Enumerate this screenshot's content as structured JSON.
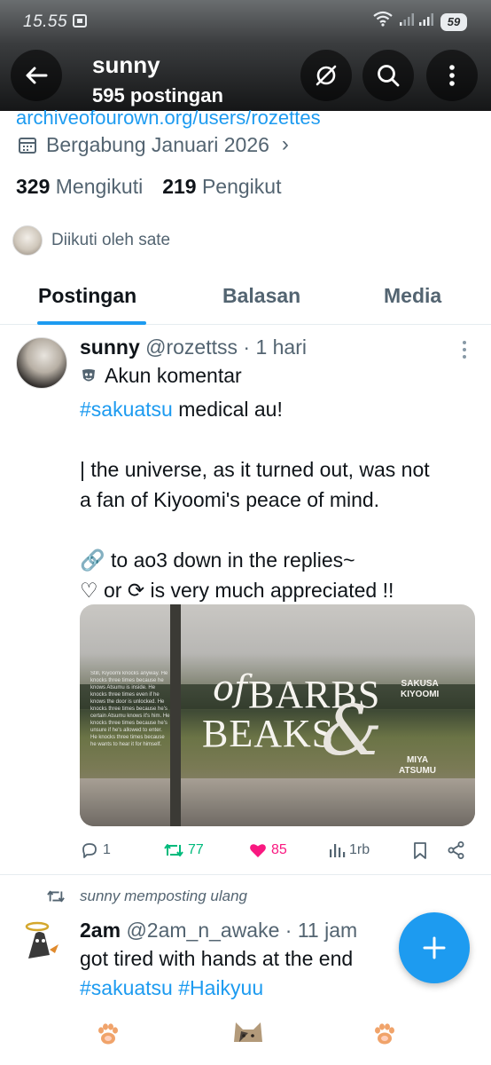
{
  "status_bar": {
    "time": "15.55",
    "battery": "59"
  },
  "header": {
    "name": "sunny",
    "post_count": "595 postingan"
  },
  "profile": {
    "link": "archiveofourown.org/users/rozettes",
    "joined": "Bergabung Januari 2026",
    "following_count": "329",
    "following_label": "Mengikuti",
    "followers_count": "219",
    "followers_label": "Pengikut",
    "followed_by": "Diikuti oleh sate"
  },
  "tabs": [
    {
      "label": "Postingan",
      "active": true
    },
    {
      "label": "Balasan",
      "active": false
    },
    {
      "label": "Media",
      "active": false
    }
  ],
  "post1": {
    "name": "sunny",
    "handle": "@rozettss",
    "time": "· 1 hari",
    "label": "Akun komentar",
    "hashtag": "#sakuatsu",
    "line1_rest": " medical au!",
    "line2": "| the universe, as it turned out, was not",
    "line3": "a fan of Kiyoomi's peace of mind.",
    "line4": "🔗 to ao3 down in the replies~",
    "line5": "♡ or ⟳ is very much appreciated !!",
    "media": {
      "title_of": "of",
      "title_barbs": "BARBS",
      "title_beaks": "BEAKS",
      "amp": "&",
      "name1_a": "SAKUSA",
      "name1_b": "KIYOOMI",
      "name2_a": "MIYA",
      "name2_b": "ATSUMU",
      "blurb": "Still, Kiyoomi knocks anyway. He knocks three times because he knows Atsumu is inside. He knocks three times even if he knows the door is unlocked. He knocks three times because he's certain Atsumu knows it's him. He knocks three times because he's unsure if he's allowed to enter. He knocks three times because he wants to hear it for himself."
    },
    "replies": "1",
    "reposts": "77",
    "likes": "85",
    "views": "1rb"
  },
  "post2": {
    "repost_label": "sunny memposting ulang",
    "name": "2am",
    "handle": "@2am_n_awake",
    "time": "· 11 jam",
    "text": "got tired with hands at the end",
    "hashtags": "#sakuatsu #Haikyuu"
  },
  "colors": {
    "accent": "#1d9bf0",
    "repost_green": "#00ba7c",
    "like_pink": "#f91880",
    "secondary_text": "#536471"
  },
  "icons": [
    "back-arrow-icon",
    "mute-icon",
    "search-icon",
    "more-vertical-icon",
    "calendar-icon",
    "chevron-right-icon",
    "mask-icon",
    "reply-icon",
    "repost-icon",
    "heart-icon",
    "views-icon",
    "bookmark-icon",
    "share-icon",
    "plus-icon",
    "paw-icon"
  ]
}
